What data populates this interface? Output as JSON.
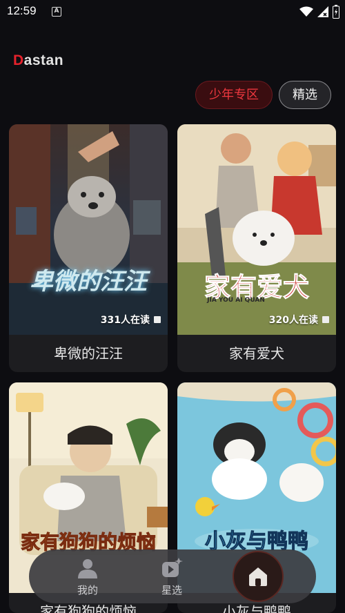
{
  "status_bar": {
    "time": "12:59",
    "notification_letter": "A"
  },
  "app": {
    "brand_first": "D",
    "brand_rest": "astan"
  },
  "filters": [
    {
      "label": "少年专区",
      "active": true
    },
    {
      "label": "精选",
      "active": false
    }
  ],
  "books": [
    {
      "title": "卑微的汪汪",
      "cover_text": "卑微的汪汪",
      "readers": "331人在读",
      "icon": "book-icon"
    },
    {
      "title": "家有爱犬",
      "cover_text": "家有爱犬",
      "cover_subtext": "JIA YOU AI QUAN",
      "readers": "320人在读",
      "icon": "book-icon"
    },
    {
      "title": "家有狗狗的烦恼",
      "cover_text": "家有狗狗的烦恼",
      "readers": "",
      "icon": "book-icon"
    },
    {
      "title": "小灰与鸭鸭",
      "cover_text": "小灰与鸭鸭",
      "readers": "",
      "icon": "book-icon"
    }
  ],
  "nav": {
    "mine_label": "我的",
    "stars_label": "星选",
    "mine_icon": "person-icon",
    "stars_icon": "star-video-icon",
    "home_icon": "home-icon"
  },
  "colors": {
    "accent": "#e5222c",
    "background": "#0d0d11",
    "card": "#1d1d20"
  }
}
